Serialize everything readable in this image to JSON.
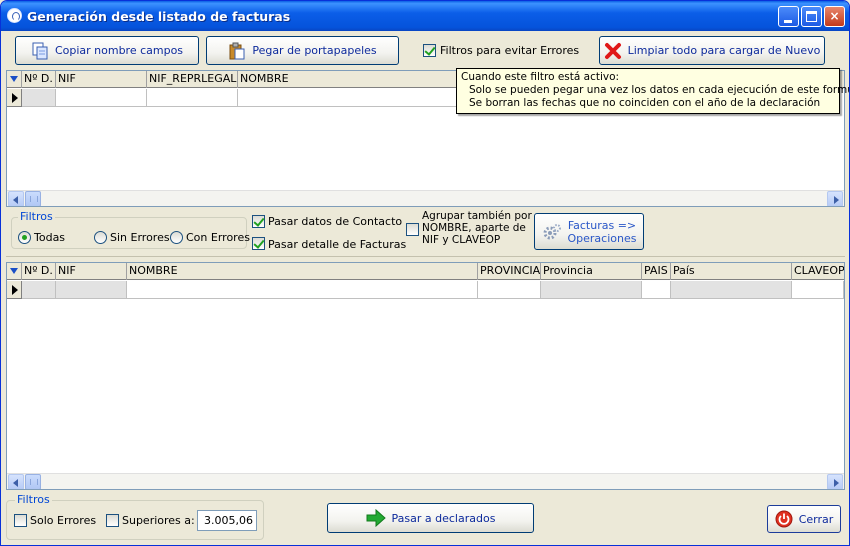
{
  "window": {
    "title": "Generación desde listado de facturas",
    "controls": {
      "minimize": "_",
      "maximize": "",
      "close": "×"
    }
  },
  "toolbar": {
    "copy_fields": "Copiar nombre campos",
    "paste_clipboard": "Pegar de portapapeles",
    "filters_check": "Filtros para evitar Errores",
    "filters_checked": true,
    "clear_all": "Limpiar todo para cargar de Nuevo"
  },
  "tooltip": {
    "heading": "Cuando este filtro está activo:",
    "lines": [
      "Solo se pueden pegar una vez los datos en cada ejecución de este formulario",
      "Se borran las fechas que no coinciden con el año de la declaración"
    ]
  },
  "grid_top": {
    "columns": [
      "Nº D.",
      "NIF",
      "NIF_REPRLEGAL",
      "NOMBRE"
    ]
  },
  "filters": {
    "title": "Filtros",
    "options": [
      "Todas",
      "Sin Errores",
      "Con Errores"
    ],
    "selected": "Todas"
  },
  "options": {
    "pass_contact": "Pasar datos de Contacto",
    "pass_contact_checked": true,
    "pass_detail": "Pasar detalle de Facturas",
    "pass_detail_checked": true,
    "group_name": [
      "Agrupar también por",
      "NOMBRE, aparte de",
      "NIF y CLAVEOP"
    ],
    "group_name_checked": false,
    "facturas_ops": [
      "Facturas =>",
      "Operaciones"
    ]
  },
  "grid_bottom": {
    "columns": [
      "Nº D.",
      "NIF",
      "NOMBRE",
      "PROVINCIA",
      "Provincia",
      "PAIS",
      "País",
      "CLAVEOP"
    ]
  },
  "bottom_filters": {
    "title": "Filtros",
    "solo_errores": "Solo Errores",
    "solo_errores_checked": false,
    "superiores": "Superiores a:",
    "superiores_checked": false,
    "superiores_value": "3.005,06"
  },
  "actions": {
    "pasar": "Pasar a declarados",
    "cerrar": "Cerrar"
  },
  "colors": {
    "title_bar": "#0553db",
    "button_text": "#0d2a9c",
    "group_title": "#0046d5",
    "tooltip_bg": "#ffffe1",
    "check_mark": "#21a121"
  }
}
